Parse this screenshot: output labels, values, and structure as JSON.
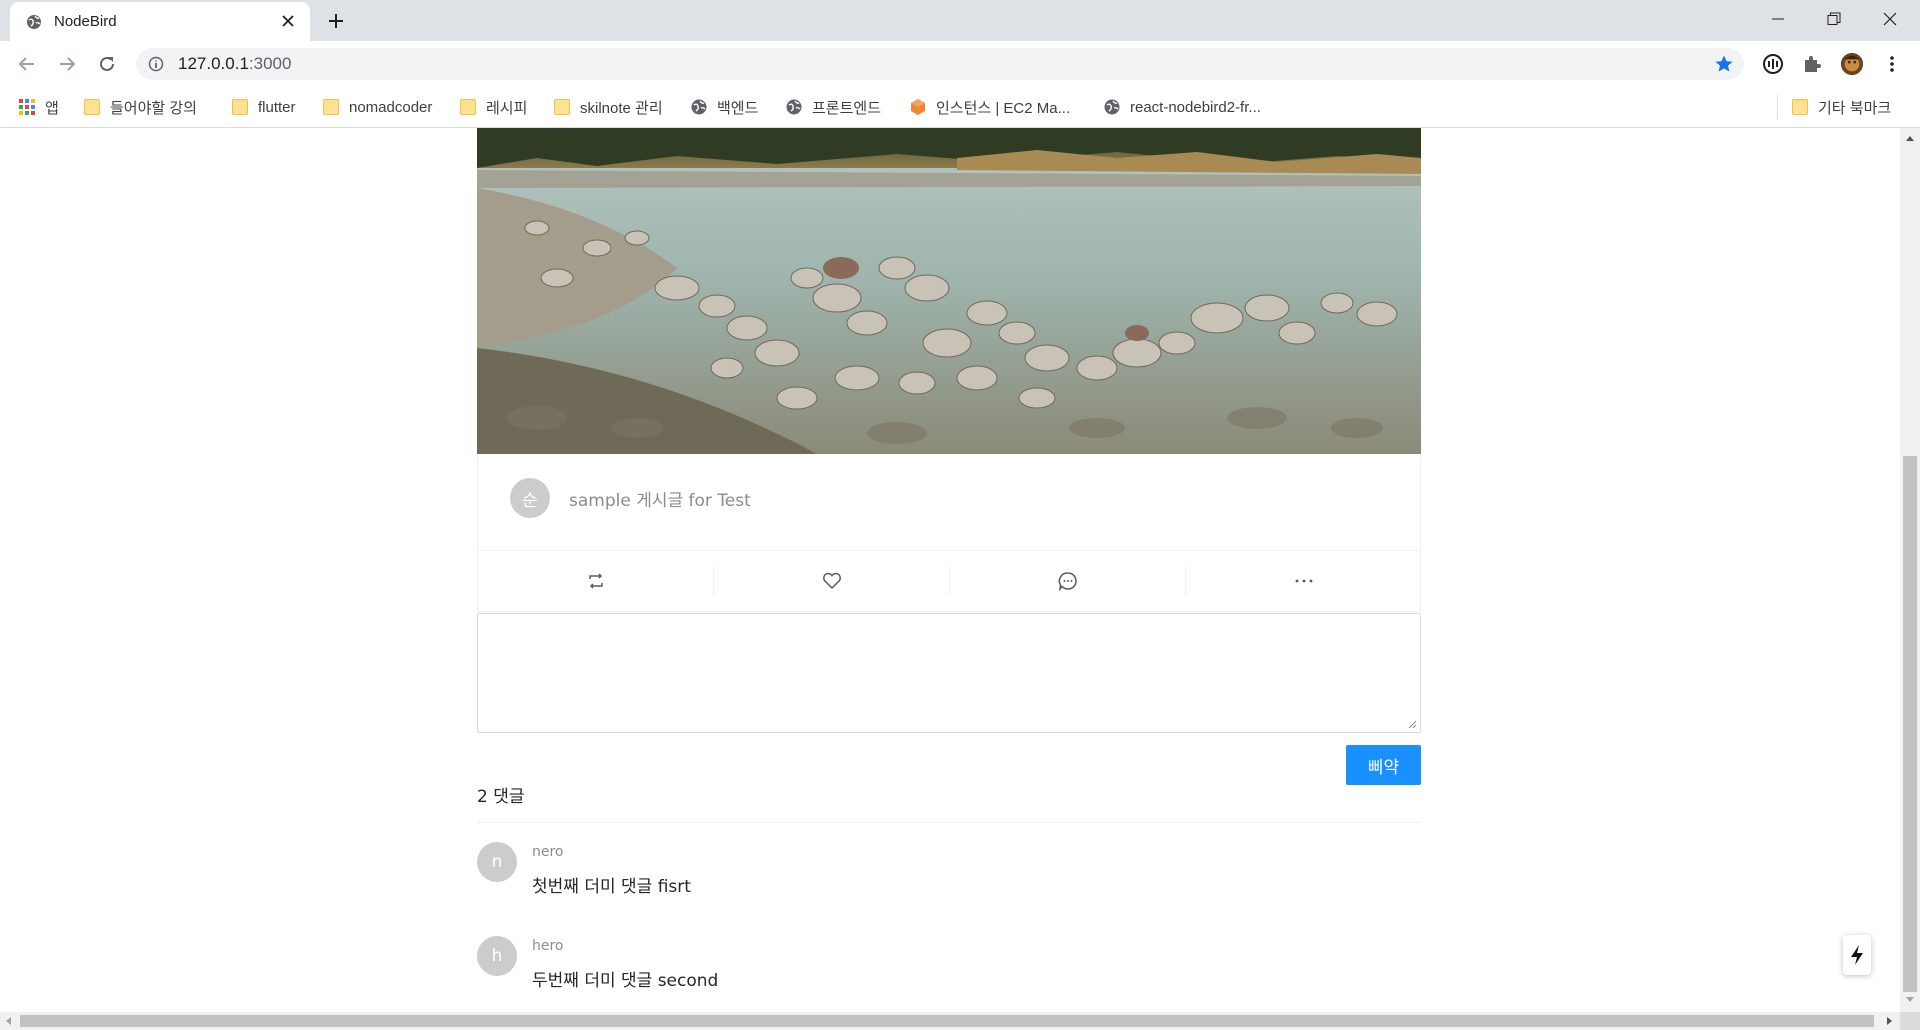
{
  "browser": {
    "tab_title": "NodeBird",
    "url_host": "127.0.0.1",
    "url_port": ":3000",
    "accent_color": "#1a73e8"
  },
  "bookmarks": {
    "apps": "앱",
    "items": [
      {
        "label": "들어야할 강의",
        "icon": "folder-icon"
      },
      {
        "label": "flutter",
        "icon": "folder-icon"
      },
      {
        "label": "nomadcoder",
        "icon": "folder-icon"
      },
      {
        "label": "레시피",
        "icon": "folder-icon"
      },
      {
        "label": "skilnote 관리",
        "icon": "folder-icon"
      },
      {
        "label": "백엔드",
        "icon": "globe-icon"
      },
      {
        "label": "프론트엔드",
        "icon": "globe-icon"
      },
      {
        "label": "인스턴스 | EC2 Ma...",
        "icon": "aws-icon"
      },
      {
        "label": "react-nodebird2-fr...",
        "icon": "globe-icon"
      }
    ],
    "other": "기타 북마크"
  },
  "post": {
    "author_initial": "순",
    "content": "sample 게시글 for Test",
    "actions": [
      "retweet-icon",
      "heart-icon",
      "message-icon",
      "ellipsis-icon"
    ]
  },
  "comment_form": {
    "value": "",
    "submit_label": "삐약",
    "submit_color": "#1890ff"
  },
  "comments": {
    "count_label": "2 댓글",
    "items": [
      {
        "initial": "n",
        "author": "nero",
        "content": "첫번째 더미 댓글 fisrt"
      },
      {
        "initial": "h",
        "author": "hero",
        "content": "두번째 더미 댓글 second"
      }
    ]
  }
}
